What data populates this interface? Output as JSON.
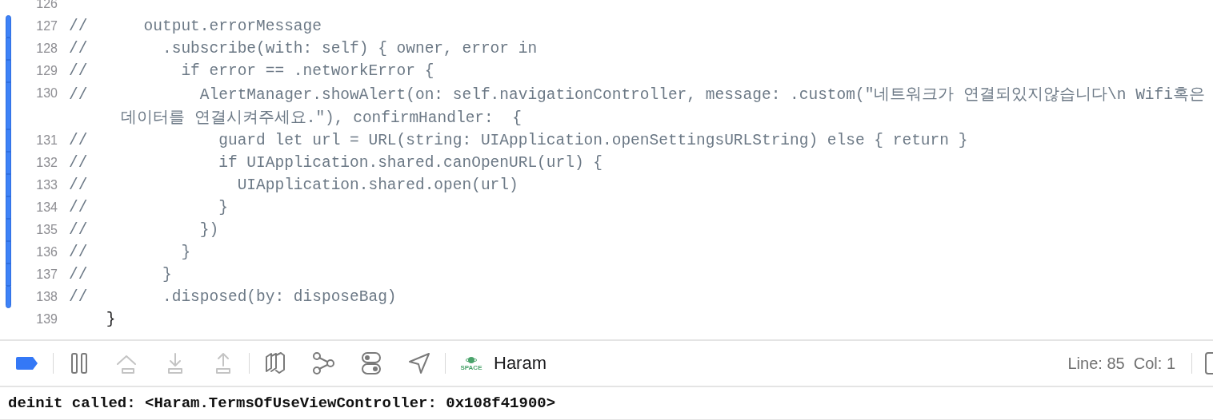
{
  "editor": {
    "lines": [
      {
        "number": "126",
        "kind": "code",
        "changed": false
      },
      {
        "number": "127",
        "kind": "comment",
        "changed": true,
        "text": "//      output.errorMessage"
      },
      {
        "number": "128",
        "kind": "comment",
        "changed": true,
        "text": "//        .subscribe(with: self) { owner, error in"
      },
      {
        "number": "129",
        "kind": "comment",
        "changed": true,
        "text": "//          if error == .networkError {"
      },
      {
        "number": "130",
        "kind": "comment",
        "changed": true,
        "text": "//            AlertManager.showAlert(on: self.navigationController, message: .custom(\"네트워크가 연결되있지않습니다\\n Wifi혹은",
        "wrap": "데이터를 연결시켜주세요.\"), confirmHandler:  {"
      },
      {
        "number": "131",
        "kind": "comment",
        "changed": true,
        "text": "//              guard let url = URL(string: UIApplication.openSettingsURLString) else { return }"
      },
      {
        "number": "132",
        "kind": "comment",
        "changed": true,
        "text": "//              if UIApplication.shared.canOpenURL(url) {"
      },
      {
        "number": "133",
        "kind": "comment",
        "changed": true,
        "text": "//                UIApplication.shared.open(url)"
      },
      {
        "number": "134",
        "kind": "comment",
        "changed": true,
        "text": "//              }"
      },
      {
        "number": "135",
        "kind": "comment",
        "changed": true,
        "text": "//            })"
      },
      {
        "number": "136",
        "kind": "comment",
        "changed": true,
        "text": "//          }"
      },
      {
        "number": "137",
        "kind": "comment",
        "changed": true,
        "text": "//        }"
      },
      {
        "number": "138",
        "kind": "comment",
        "changed": true,
        "text": "//        .disposed(by: disposeBag)"
      },
      {
        "number": "139",
        "kind": "code",
        "changed": false,
        "text": "    }"
      }
    ]
  },
  "debug_bar": {
    "buttons": [
      {
        "kind": "breakpoints",
        "selected": true,
        "disabled": false
      },
      {
        "kind": "divider"
      },
      {
        "kind": "pause",
        "disabled": false
      },
      {
        "kind": "step_over",
        "disabled": true
      },
      {
        "kind": "step_into",
        "disabled": true
      },
      {
        "kind": "step_out",
        "disabled": true
      },
      {
        "kind": "divider"
      },
      {
        "kind": "view_debugger",
        "disabled": false
      },
      {
        "kind": "memory_graph",
        "disabled": false
      },
      {
        "kind": "environment",
        "disabled": false
      },
      {
        "kind": "location",
        "disabled": false
      },
      {
        "kind": "divider"
      }
    ],
    "target": {
      "icon_label": "SPACE",
      "name": "Haram"
    },
    "position": "Line: 85  Col: 1"
  },
  "console": {
    "lines": [
      "deinit called: <Haram.TermsOfUseViewController: 0x108f41900>"
    ]
  }
}
